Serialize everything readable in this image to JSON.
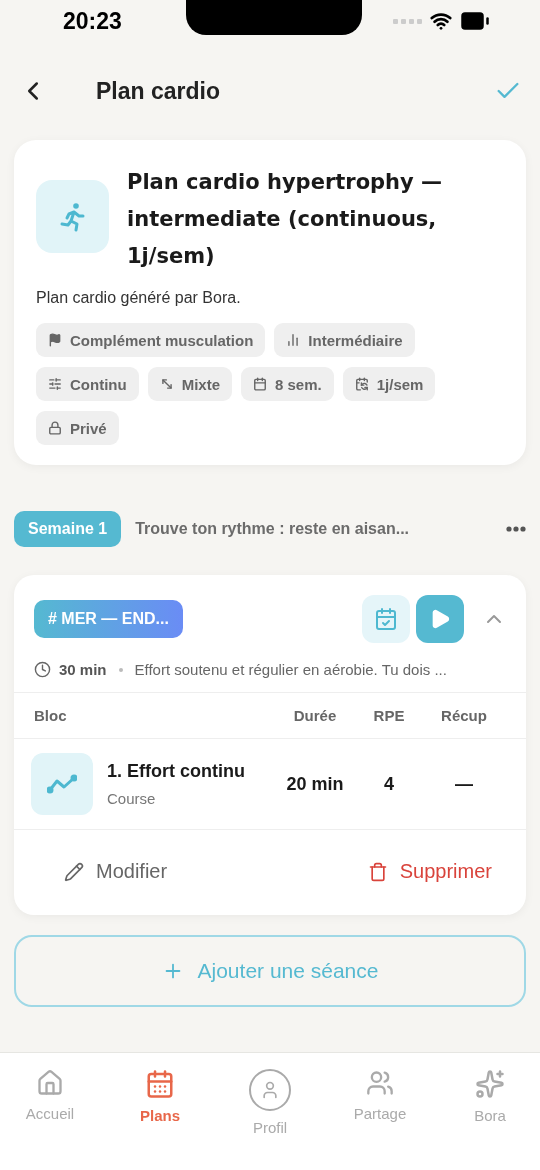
{
  "status_bar": {
    "time": "20:23"
  },
  "header": {
    "title": "Plan cardio"
  },
  "plan": {
    "title": "Plan cardio hypertrophy — intermediate (continuous, 1j/sem)",
    "description": "Plan cardio généré par Bora.",
    "tags": [
      {
        "kind": "goal",
        "label": "Complément musculation"
      },
      {
        "kind": "level",
        "label": "Intermédiaire"
      },
      {
        "kind": "method",
        "label": "Continu"
      },
      {
        "kind": "mode",
        "label": "Mixte"
      },
      {
        "kind": "duration",
        "label": "8 sem."
      },
      {
        "kind": "frequency",
        "label": "1j/sem"
      },
      {
        "kind": "privacy",
        "label": "Privé"
      }
    ]
  },
  "week": {
    "badge": "Semaine 1",
    "subtitle": "Trouve ton rythme : reste en aisan..."
  },
  "session": {
    "tag": "# MER — END...",
    "expanded": true,
    "duration": "30 min",
    "summary": "Effort soutenu et régulier en aérobie. Tu dois ...",
    "columns": [
      "Bloc",
      "Durée",
      "RPE",
      "Récup"
    ],
    "rows": [
      {
        "name": "1. Effort continu",
        "sport": "Course",
        "duration": "20 min",
        "rpe": "4",
        "rest": "—"
      }
    ],
    "actions": [
      {
        "kind": "edit",
        "label": "Modifier"
      },
      {
        "kind": "delete",
        "label": "Supprimer"
      }
    ]
  },
  "add_button": "Ajouter une séance",
  "tab_bar": [
    {
      "kind": "home",
      "label": "Accueil",
      "selected": false
    },
    {
      "kind": "plans",
      "label": "Plans",
      "selected": true
    },
    {
      "kind": "profile",
      "label": "Profil",
      "selected": false
    },
    {
      "kind": "share",
      "label": "Partage",
      "selected": false
    },
    {
      "kind": "ai",
      "label": "Bora",
      "selected": false
    }
  ]
}
